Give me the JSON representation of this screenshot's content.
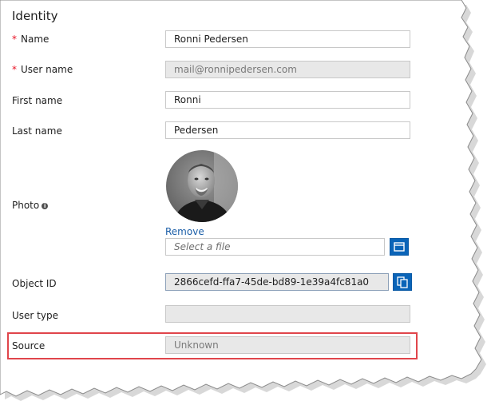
{
  "section": {
    "heading": "Identity"
  },
  "fields": {
    "name": {
      "label": "Name",
      "required": "*",
      "value": "Ronni Pedersen"
    },
    "user_name": {
      "label": "User name",
      "required": "*",
      "value": "mail@ronnipedersen.com"
    },
    "first_name": {
      "label": "First name",
      "value": "Ronni"
    },
    "last_name": {
      "label": "Last name",
      "value": "Pedersen"
    },
    "photo": {
      "label": "Photo",
      "info": "i",
      "remove": "Remove",
      "file_placeholder": "Select a file"
    },
    "object_id": {
      "label": "Object ID",
      "value": "2866cefd-ffa7-45de-bd89-1e39a4fc81a0"
    },
    "user_type": {
      "label": "User type",
      "value": ""
    },
    "source": {
      "label": "Source",
      "value": "Unknown"
    }
  },
  "colors": {
    "accent": "#0a64b8",
    "required": "#e81123",
    "highlight": "#e0454b",
    "link": "#1c5fa8"
  },
  "icons": {
    "folder": "folder-icon",
    "copy": "copy-icon",
    "info": "info-icon"
  }
}
